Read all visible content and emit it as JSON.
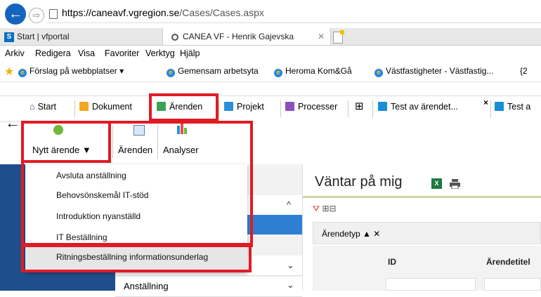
{
  "browser": {
    "url_host": "https://caneavf.vgregion.se",
    "url_path": "/Cases/Cases.aspx",
    "tabs": [
      {
        "label": "Start | vfportal"
      },
      {
        "label": "CANEA VF - Henrik Gajevska"
      }
    ],
    "menu": [
      "Arkiv",
      "Redigera",
      "Visa",
      "Favoriter",
      "Verktyg",
      "Hjälp"
    ],
    "favorites": [
      "Förslag på webbplatser",
      "Gemensam arbetsyta",
      "Heroma Kom&Gå",
      "Västfastigheter - Västfastig...",
      "{2"
    ]
  },
  "nav": {
    "items": [
      "Start",
      "Dokument",
      "Ärenden",
      "Projekt",
      "Processer",
      "Test av ärendet...",
      "Test a"
    ]
  },
  "toolbar": {
    "new_case": "Nytt ärende",
    "cases": "Ärenden",
    "analyses": "Analyser"
  },
  "dropdown": {
    "items": [
      "Avsluta anställning",
      "Behovsönskemål IT-stöd",
      "Introduktion nyanställd",
      "IT Beställning",
      "Ritningsbeställning informationsunderlag"
    ]
  },
  "sidebar": {
    "bottom_item": "Anställning"
  },
  "main": {
    "title": "Väntar på mig",
    "excel_label": "X",
    "filter_chip": "Ärendetyp",
    "columns": [
      "ID",
      "Ärendetitel"
    ]
  }
}
